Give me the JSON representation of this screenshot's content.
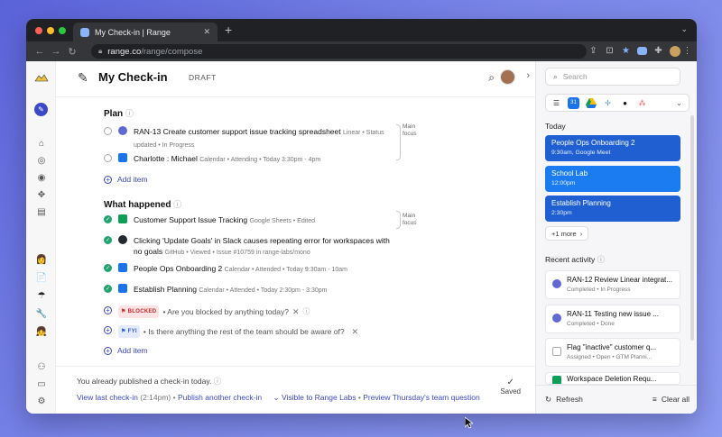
{
  "browser": {
    "tab_title": "My Check-in | Range",
    "url_host": "range.co",
    "url_path": "/range/compose"
  },
  "header": {
    "title": "My Check-in",
    "status": "DRAFT"
  },
  "plan": {
    "title": "Plan",
    "items": [
      {
        "text": "RAN-13 Create customer support issue tracking spreadsheet",
        "meta": "Linear • Status",
        "meta2": "updated • In Progress"
      },
      {
        "text": "Charlotte : Michael",
        "meta": "Calendar • Attending • Today 3:30pm - 4pm"
      }
    ],
    "add_label": "Add item",
    "focus_label_1": "Main",
    "focus_label_2": "focus"
  },
  "happened": {
    "title": "What happened",
    "items": [
      {
        "text": "Customer Support Issue Tracking",
        "meta": "Google Sheets • Edited"
      },
      {
        "text": "Clicking 'Update Goals' in Slack causes repeating error for workspaces with",
        "text2": "no goals",
        "meta": "GitHub • Viewed • Issue #10759 in range-labs/mono"
      },
      {
        "text": "People Ops Onboarding 2",
        "meta": "Calendar • Attended • Today 9:30am - 10am"
      },
      {
        "text": "Establish Planning",
        "meta": "Calendar • Attended • Today 2:30pm - 3:30pm"
      }
    ],
    "blocked_badge": "BLOCKED",
    "blocked_prompt": "• Are you blocked by anything today?",
    "fyi_badge": "FYI",
    "fyi_prompt": "• Is there anything the rest of the team should be aware of?",
    "add_label": "Add item",
    "focus_label_1": "Main",
    "focus_label_2": "focus"
  },
  "footer": {
    "notice": "You already published a check-in today.",
    "view_last": "View last check-in",
    "view_time": "(2:14pm)",
    "sep": "•",
    "publish_another": "Publish another check-in",
    "visible_to": "Visible to Range Labs",
    "preview": "Preview Thursday's team question",
    "saved": "Saved"
  },
  "sidebar": {
    "search_placeholder": "Search",
    "today_label": "Today",
    "events": [
      {
        "title": "People Ops Onboarding 2",
        "sub": "9:30am, Google Meet",
        "color": "#1f5fd1"
      },
      {
        "title": "School Lab",
        "sub": "12:00pm",
        "color": "#1a7cf0"
      },
      {
        "title": "Establish Planning",
        "sub": "2:30pm",
        "color": "#1f5fd1"
      }
    ],
    "more_label": "+1 more",
    "recent_label": "Recent activity",
    "activity": [
      {
        "title": "RAN-12 Review Linear integrat...",
        "sub": "Completed • In Progress"
      },
      {
        "title": "RAN-11 Testing new issue ...",
        "sub": "Completed • Done"
      },
      {
        "title": "Flag \"inactive\" customer q...",
        "sub": "Assigned • Open • GTM Planni..."
      },
      {
        "title": "Workspace Deletion Requ...",
        "sub": ""
      }
    ],
    "refresh_label": "Refresh",
    "clear_label": "Clear all"
  }
}
